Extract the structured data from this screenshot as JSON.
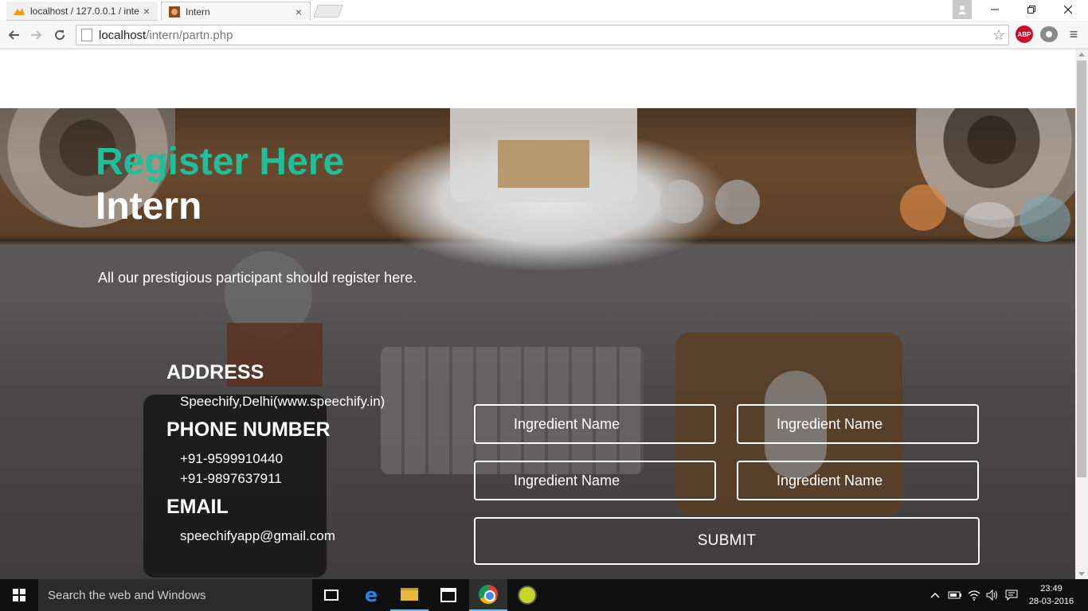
{
  "browser": {
    "tabs": [
      {
        "title": "localhost / 127.0.0.1 / inte",
        "favicon": "phpmyadmin-icon",
        "active": false
      },
      {
        "title": "Intern",
        "favicon": "page-favicon",
        "active": true
      }
    ],
    "tab_close_glyph": "×",
    "address": {
      "host": "localhost",
      "path": "/intern/partn.php"
    },
    "extensions": {
      "abp_label": "ABP"
    }
  },
  "page": {
    "heading": "Register Here",
    "subheading": "Intern",
    "description": "All our prestigious participant should register here.",
    "colors": {
      "accent": "#1fbf9a",
      "text": "#ffffff"
    },
    "contact": {
      "address_heading": "ADDRESS",
      "address": "Speechify,Delhi(www.speechify.in)",
      "phone_heading": "PHONE NUMBER",
      "phones": [
        "+91-9599910440",
        "+91-9897637911"
      ],
      "email_heading": "EMAIL",
      "email": "speechifyapp@gmail.com"
    },
    "form": {
      "fields": [
        {
          "placeholder": "Ingredient Name",
          "value": ""
        },
        {
          "placeholder": "Ingredient Name",
          "value": ""
        },
        {
          "placeholder": "Ingredient Name",
          "value": ""
        },
        {
          "placeholder": "Ingredient Name",
          "value": ""
        }
      ],
      "submit_label": "SUBMIT"
    }
  },
  "taskbar": {
    "search_placeholder": "Search the web and Windows",
    "pinned": [
      "task-view-icon",
      "edge-icon",
      "file-explorer-icon",
      "store-icon",
      "chrome-icon",
      "app-icon"
    ],
    "clock": {
      "time": "23:49",
      "date": "28-03-2016"
    }
  }
}
